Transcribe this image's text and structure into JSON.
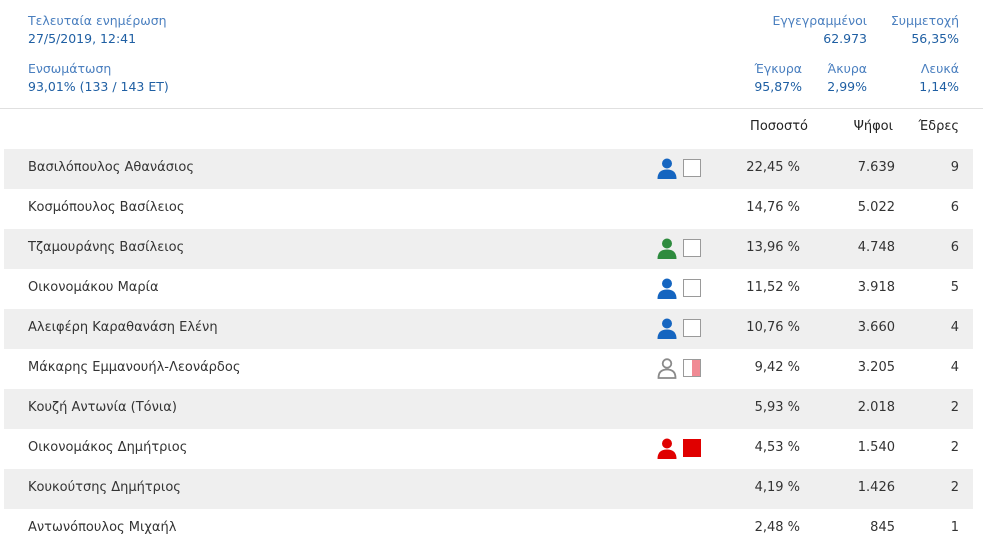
{
  "header": {
    "last_update_label": "Τελευταία ενημέρωση",
    "last_update_value": "27/5/2019, 12:41",
    "integration_label": "Ενσωμάτωση",
    "integration_value": "93,01% (133 / 143 ΕΤ)",
    "registered_label": "Εγγεγραμμένοι",
    "registered_value": "62.973",
    "turnout_label": "Συμμετοχή",
    "turnout_value": "56,35%",
    "valid_label": "Έγκυρα",
    "valid_value": "95,87%",
    "invalid_label": "Άκυρα",
    "invalid_value": "2,99%",
    "blank_label": "Λευκά",
    "blank_value": "1,14%"
  },
  "columns": {
    "percent": "Ποσοστό",
    "votes": "Ψήφοι",
    "seats": "Έδρες"
  },
  "colors": {
    "blue": "#1565c0",
    "green": "#2e8b3e",
    "gray": "#8a8a8a",
    "red": "#e00000",
    "pink": "#f08a94"
  },
  "rows": [
    {
      "name": "Βασιλόπουλος Αθανάσιος",
      "percent": "22,45 %",
      "votes": "7.639",
      "seats": "9",
      "icon": "person-blue",
      "box": "empty"
    },
    {
      "name": "Κοσμόπουλος Βασίλειος",
      "percent": "14,76 %",
      "votes": "5.022",
      "seats": "6",
      "icon": "",
      "box": ""
    },
    {
      "name": "Τζαμουράνης Βασίλειος",
      "percent": "13,96 %",
      "votes": "4.748",
      "seats": "6",
      "icon": "person-green",
      "box": "empty"
    },
    {
      "name": "Οικονομάκου Μαρία",
      "percent": "11,52 %",
      "votes": "3.918",
      "seats": "5",
      "icon": "person-blue",
      "box": "empty"
    },
    {
      "name": "Αλειφέρη Καραθανάση Ελένη",
      "percent": "10,76 %",
      "votes": "3.660",
      "seats": "4",
      "icon": "person-blue",
      "box": "empty"
    },
    {
      "name": "Μάκαρης Εμμανουήλ-Λεονάρδος",
      "percent": "9,42 %",
      "votes": "3.205",
      "seats": "4",
      "icon": "person-outline-gray",
      "box": "half-pink"
    },
    {
      "name": "Κουζή Αντωνία (Τόνια)",
      "percent": "5,93 %",
      "votes": "2.018",
      "seats": "2",
      "icon": "",
      "box": ""
    },
    {
      "name": "Οικονομάκος Δημήτριος",
      "percent": "4,53 %",
      "votes": "1.540",
      "seats": "2",
      "icon": "person-red",
      "box": "solid-red"
    },
    {
      "name": "Κουκούτσης Δημήτριος",
      "percent": "4,19 %",
      "votes": "1.426",
      "seats": "2",
      "icon": "",
      "box": ""
    },
    {
      "name": "Αντωνόπουλος Μιχαήλ",
      "percent": "2,48 %",
      "votes": "845",
      "seats": "1",
      "icon": "",
      "box": ""
    }
  ]
}
